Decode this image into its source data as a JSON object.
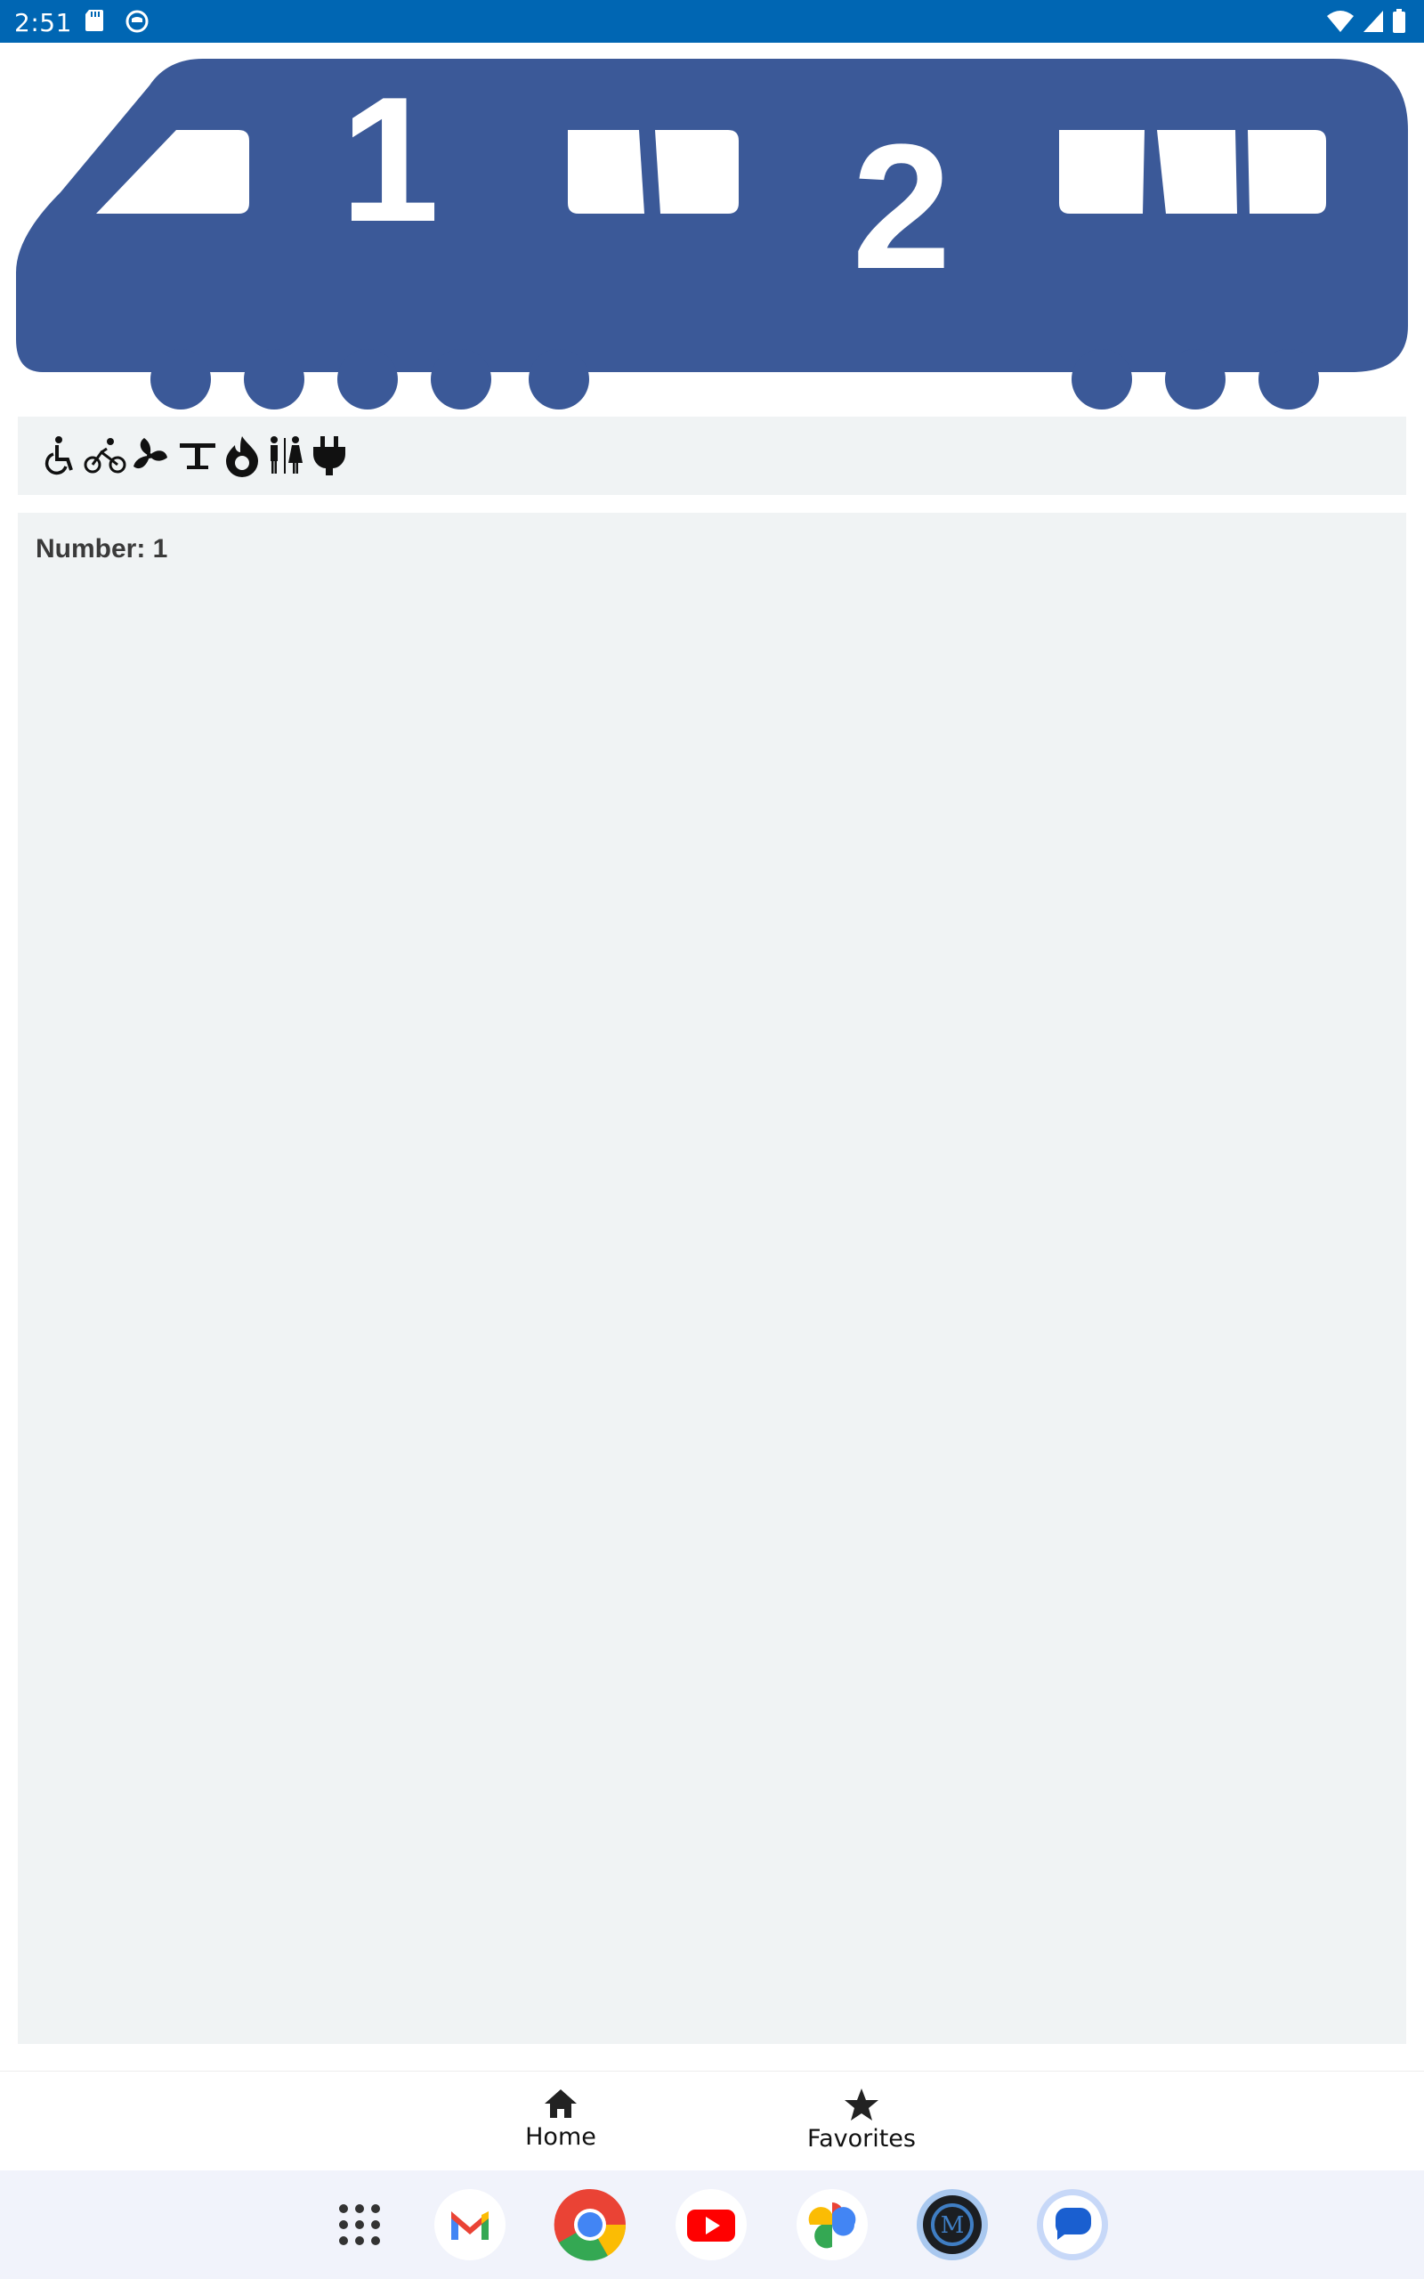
{
  "status_bar": {
    "time": "2:51",
    "left_icons": [
      "sd-card-icon",
      "cat-face-icon"
    ],
    "right_icons": [
      "wifi-icon",
      "cell-signal-icon",
      "battery-icon"
    ],
    "background": "#0066b3"
  },
  "train": {
    "car_numbers": [
      "1",
      "2"
    ],
    "color": "#3b5998"
  },
  "amenities": [
    "wheelchair-icon",
    "bicycle-icon",
    "fan-icon",
    "table-icon",
    "flame-icon",
    "restroom-icon",
    "power-plug-icon"
  ],
  "details": {
    "number_text": "Number: 1"
  },
  "tabs": [
    {
      "label": "Home",
      "icon": "home-icon"
    },
    {
      "label": "Favorites",
      "icon": "star-icon"
    }
  ],
  "dock_apps": [
    "app-drawer",
    "gmail",
    "chrome",
    "youtube",
    "photos",
    "metro-app",
    "messages"
  ]
}
